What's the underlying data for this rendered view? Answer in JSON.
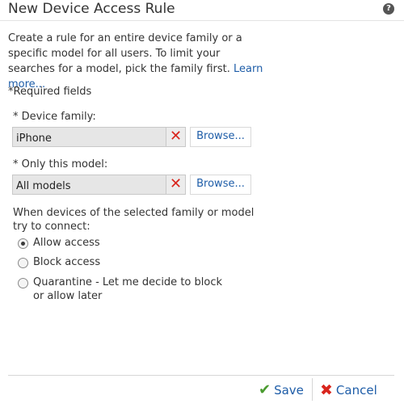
{
  "dialog": {
    "title": "New Device Access Rule",
    "help_glyph": "?"
  },
  "description": {
    "text": "Create a rule for an entire device family or a specific model for all users. To limit your searches for a model, pick the family first.",
    "link": "Learn more..."
  },
  "required_note": "*Required fields",
  "device_family": {
    "label": "* Device family:",
    "value": "iPhone",
    "clear_glyph": "✕",
    "browse_label": "Browse..."
  },
  "model": {
    "label": "* Only this model:",
    "value": "All models",
    "clear_glyph": "✕",
    "browse_label": "Browse..."
  },
  "connect_question": "When devices of the selected family or model try to connect:",
  "options": [
    {
      "label": "Allow access",
      "checked": true
    },
    {
      "label": "Block access",
      "checked": false
    },
    {
      "label": "Quarantine - Let me decide to block or allow later",
      "checked": false
    }
  ],
  "footer": {
    "save_label": "Save",
    "save_icon": "✔",
    "cancel_label": "Cancel",
    "cancel_icon": "✖"
  },
  "colors": {
    "link": "#1e5da8",
    "clear_x": "#d9251d",
    "save_check": "#4a9b2f"
  },
  "icons": [
    "help-icon",
    "clear-x-icon",
    "checkmark-icon",
    "cancel-x-icon"
  ]
}
